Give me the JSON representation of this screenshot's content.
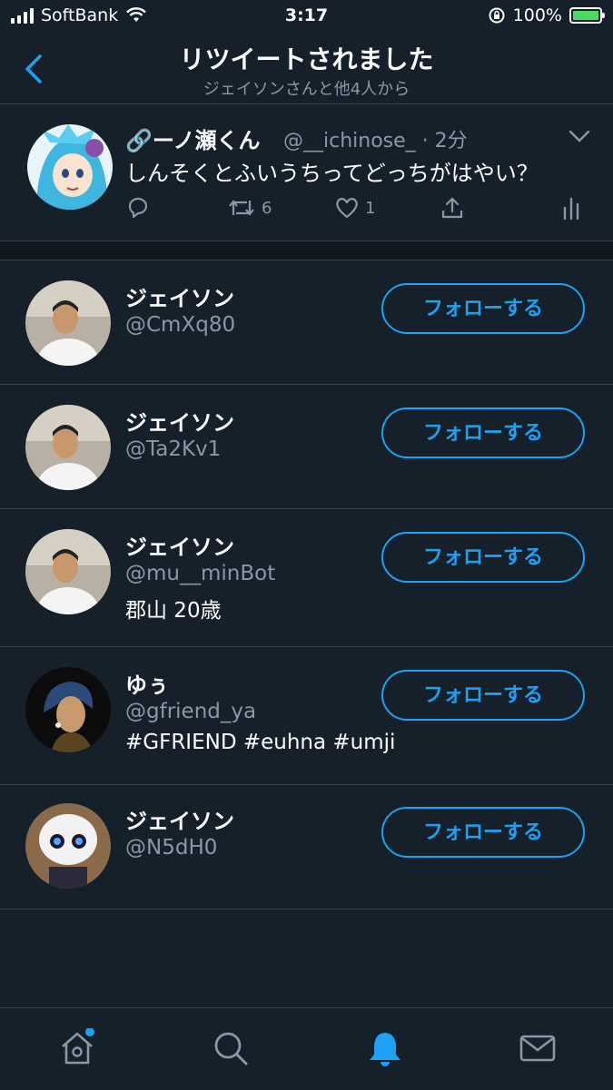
{
  "status_bar": {
    "carrier": "SoftBank",
    "time": "3:17",
    "battery": "100%"
  },
  "header": {
    "title": "リツイートされました",
    "subtitle": "ジェイソンさんと他4人から"
  },
  "tweet": {
    "name": "🔗ーノ瀬くん",
    "handle_time": "@__ichinose_ · 2分",
    "text": "しんそくとふいうちってどっちがはやい？",
    "retweets": "6",
    "likes": "1"
  },
  "users": [
    {
      "name": "ジェイソン",
      "handle": "@CmXq80",
      "bio": "",
      "follow_label": "フォローする"
    },
    {
      "name": "ジェイソン",
      "handle": "@Ta2Kv1",
      "bio": "",
      "follow_label": "フォローする"
    },
    {
      "name": "ジェイソン",
      "handle": "@mu__minBot",
      "bio": "郡山 20歳",
      "follow_label": "フォローする"
    },
    {
      "name": "ゆぅ",
      "handle": "@gfriend_ya",
      "bio": "#GFRIEND #euhna #umji",
      "follow_label": "フォローする"
    },
    {
      "name": "ジェイソン",
      "handle": "@N5dH0",
      "bio": "",
      "follow_label": "フォローする"
    }
  ],
  "colors": {
    "background": "#15202b",
    "accent": "#1da1f2",
    "secondary_text": "#8899a6",
    "divider": "#38444d"
  },
  "icons": [
    "back-chevron-icon",
    "reply-icon",
    "retweet-icon",
    "like-icon",
    "share-icon",
    "analytics-icon",
    "home-icon",
    "search-icon",
    "notifications-icon",
    "messages-icon"
  ]
}
